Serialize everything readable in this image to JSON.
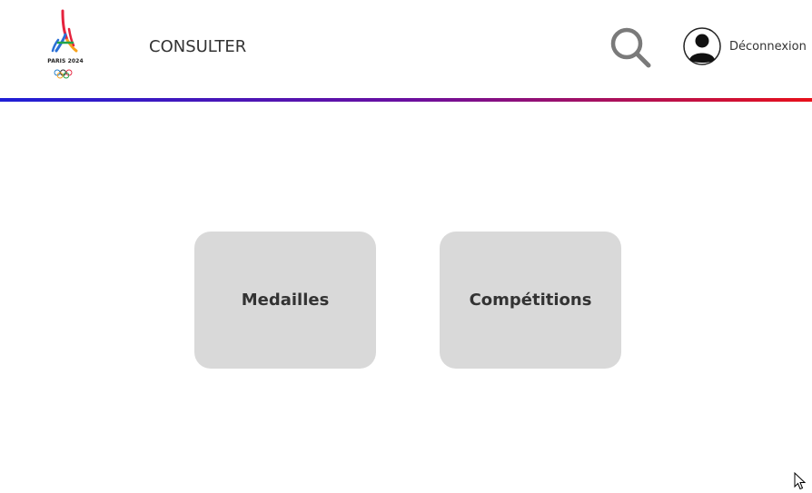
{
  "header": {
    "logo_text": "PARIS 2024",
    "nav_label": "CONSULTER",
    "search_icon": "search-icon",
    "avatar_icon": "user-avatar-icon",
    "logout_label": "Déconnexion"
  },
  "colors": {
    "gradient_start": "#1f1fd6",
    "gradient_mid": "#6a0fa0",
    "gradient_end": "#e8101a",
    "card_bg": "#d9d9d9"
  },
  "main": {
    "cards": [
      {
        "label": "Medailles"
      },
      {
        "label": "Compétitions"
      }
    ]
  }
}
